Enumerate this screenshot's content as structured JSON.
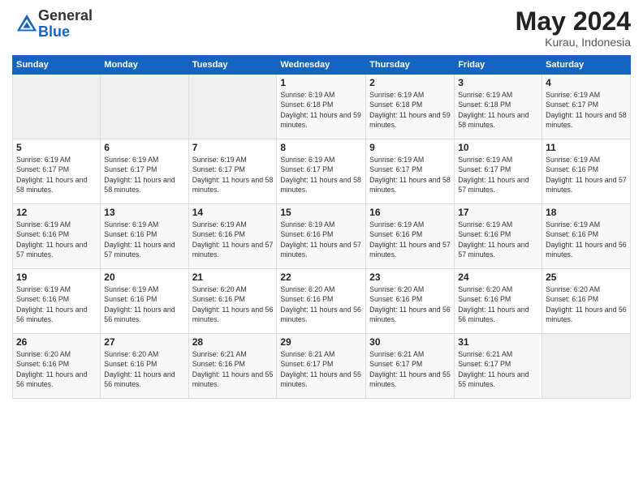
{
  "logo": {
    "general": "General",
    "blue": "Blue"
  },
  "title": {
    "month": "May 2024",
    "location": "Kurau, Indonesia"
  },
  "days_of_week": [
    "Sunday",
    "Monday",
    "Tuesday",
    "Wednesday",
    "Thursday",
    "Friday",
    "Saturday"
  ],
  "weeks": [
    [
      {
        "day": "",
        "sunrise": "",
        "sunset": "",
        "daylight": ""
      },
      {
        "day": "",
        "sunrise": "",
        "sunset": "",
        "daylight": ""
      },
      {
        "day": "",
        "sunrise": "",
        "sunset": "",
        "daylight": ""
      },
      {
        "day": "1",
        "sunrise": "Sunrise: 6:19 AM",
        "sunset": "Sunset: 6:18 PM",
        "daylight": "Daylight: 11 hours and 59 minutes."
      },
      {
        "day": "2",
        "sunrise": "Sunrise: 6:19 AM",
        "sunset": "Sunset: 6:18 PM",
        "daylight": "Daylight: 11 hours and 59 minutes."
      },
      {
        "day": "3",
        "sunrise": "Sunrise: 6:19 AM",
        "sunset": "Sunset: 6:18 PM",
        "daylight": "Daylight: 11 hours and 58 minutes."
      },
      {
        "day": "4",
        "sunrise": "Sunrise: 6:19 AM",
        "sunset": "Sunset: 6:17 PM",
        "daylight": "Daylight: 11 hours and 58 minutes."
      }
    ],
    [
      {
        "day": "5",
        "sunrise": "Sunrise: 6:19 AM",
        "sunset": "Sunset: 6:17 PM",
        "daylight": "Daylight: 11 hours and 58 minutes."
      },
      {
        "day": "6",
        "sunrise": "Sunrise: 6:19 AM",
        "sunset": "Sunset: 6:17 PM",
        "daylight": "Daylight: 11 hours and 58 minutes."
      },
      {
        "day": "7",
        "sunrise": "Sunrise: 6:19 AM",
        "sunset": "Sunset: 6:17 PM",
        "daylight": "Daylight: 11 hours and 58 minutes."
      },
      {
        "day": "8",
        "sunrise": "Sunrise: 6:19 AM",
        "sunset": "Sunset: 6:17 PM",
        "daylight": "Daylight: 11 hours and 58 minutes."
      },
      {
        "day": "9",
        "sunrise": "Sunrise: 6:19 AM",
        "sunset": "Sunset: 6:17 PM",
        "daylight": "Daylight: 11 hours and 58 minutes."
      },
      {
        "day": "10",
        "sunrise": "Sunrise: 6:19 AM",
        "sunset": "Sunset: 6:17 PM",
        "daylight": "Daylight: 11 hours and 57 minutes."
      },
      {
        "day": "11",
        "sunrise": "Sunrise: 6:19 AM",
        "sunset": "Sunset: 6:16 PM",
        "daylight": "Daylight: 11 hours and 57 minutes."
      }
    ],
    [
      {
        "day": "12",
        "sunrise": "Sunrise: 6:19 AM",
        "sunset": "Sunset: 6:16 PM",
        "daylight": "Daylight: 11 hours and 57 minutes."
      },
      {
        "day": "13",
        "sunrise": "Sunrise: 6:19 AM",
        "sunset": "Sunset: 6:16 PM",
        "daylight": "Daylight: 11 hours and 57 minutes."
      },
      {
        "day": "14",
        "sunrise": "Sunrise: 6:19 AM",
        "sunset": "Sunset: 6:16 PM",
        "daylight": "Daylight: 11 hours and 57 minutes."
      },
      {
        "day": "15",
        "sunrise": "Sunrise: 6:19 AM",
        "sunset": "Sunset: 6:16 PM",
        "daylight": "Daylight: 11 hours and 57 minutes."
      },
      {
        "day": "16",
        "sunrise": "Sunrise: 6:19 AM",
        "sunset": "Sunset: 6:16 PM",
        "daylight": "Daylight: 11 hours and 57 minutes."
      },
      {
        "day": "17",
        "sunrise": "Sunrise: 6:19 AM",
        "sunset": "Sunset: 6:16 PM",
        "daylight": "Daylight: 11 hours and 57 minutes."
      },
      {
        "day": "18",
        "sunrise": "Sunrise: 6:19 AM",
        "sunset": "Sunset: 6:16 PM",
        "daylight": "Daylight: 11 hours and 56 minutes."
      }
    ],
    [
      {
        "day": "19",
        "sunrise": "Sunrise: 6:19 AM",
        "sunset": "Sunset: 6:16 PM",
        "daylight": "Daylight: 11 hours and 56 minutes."
      },
      {
        "day": "20",
        "sunrise": "Sunrise: 6:19 AM",
        "sunset": "Sunset: 6:16 PM",
        "daylight": "Daylight: 11 hours and 56 minutes."
      },
      {
        "day": "21",
        "sunrise": "Sunrise: 6:20 AM",
        "sunset": "Sunset: 6:16 PM",
        "daylight": "Daylight: 11 hours and 56 minutes."
      },
      {
        "day": "22",
        "sunrise": "Sunrise: 6:20 AM",
        "sunset": "Sunset: 6:16 PM",
        "daylight": "Daylight: 11 hours and 56 minutes."
      },
      {
        "day": "23",
        "sunrise": "Sunrise: 6:20 AM",
        "sunset": "Sunset: 6:16 PM",
        "daylight": "Daylight: 11 hours and 56 minutes."
      },
      {
        "day": "24",
        "sunrise": "Sunrise: 6:20 AM",
        "sunset": "Sunset: 6:16 PM",
        "daylight": "Daylight: 11 hours and 56 minutes."
      },
      {
        "day": "25",
        "sunrise": "Sunrise: 6:20 AM",
        "sunset": "Sunset: 6:16 PM",
        "daylight": "Daylight: 11 hours and 56 minutes."
      }
    ],
    [
      {
        "day": "26",
        "sunrise": "Sunrise: 6:20 AM",
        "sunset": "Sunset: 6:16 PM",
        "daylight": "Daylight: 11 hours and 56 minutes."
      },
      {
        "day": "27",
        "sunrise": "Sunrise: 6:20 AM",
        "sunset": "Sunset: 6:16 PM",
        "daylight": "Daylight: 11 hours and 56 minutes."
      },
      {
        "day": "28",
        "sunrise": "Sunrise: 6:21 AM",
        "sunset": "Sunset: 6:16 PM",
        "daylight": "Daylight: 11 hours and 55 minutes."
      },
      {
        "day": "29",
        "sunrise": "Sunrise: 6:21 AM",
        "sunset": "Sunset: 6:17 PM",
        "daylight": "Daylight: 11 hours and 55 minutes."
      },
      {
        "day": "30",
        "sunrise": "Sunrise: 6:21 AM",
        "sunset": "Sunset: 6:17 PM",
        "daylight": "Daylight: 11 hours and 55 minutes."
      },
      {
        "day": "31",
        "sunrise": "Sunrise: 6:21 AM",
        "sunset": "Sunset: 6:17 PM",
        "daylight": "Daylight: 11 hours and 55 minutes."
      },
      {
        "day": "",
        "sunrise": "",
        "sunset": "",
        "daylight": ""
      }
    ]
  ]
}
